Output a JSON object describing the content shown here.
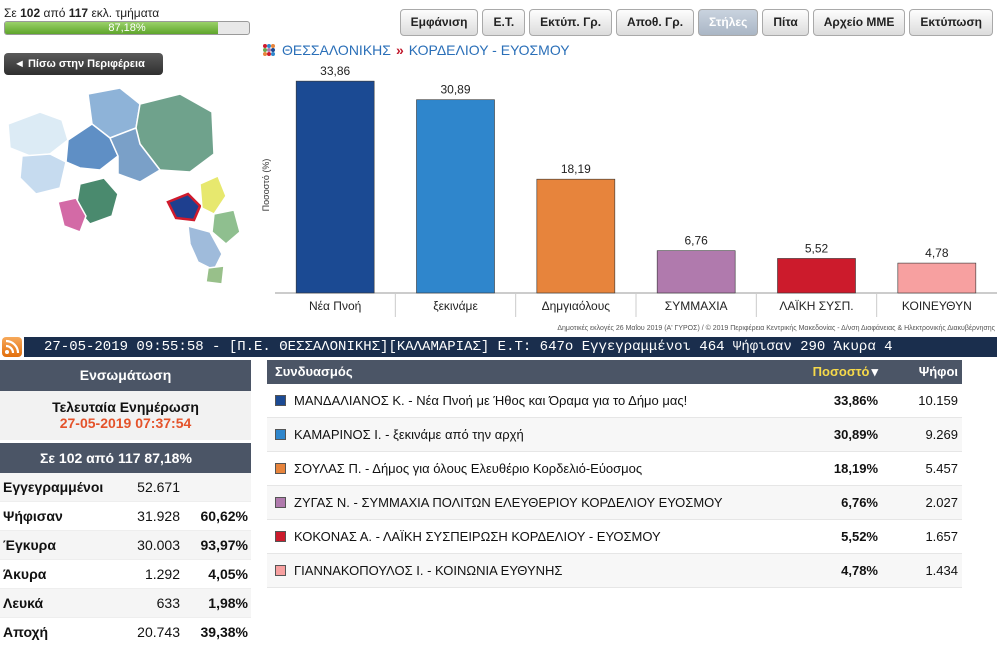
{
  "progress": {
    "prefix": "Σε",
    "counted": "102",
    "middle": "από",
    "total": "117",
    "suffix": "εκλ. τμήματα",
    "percent_label": "87,18%",
    "fraction": 0.8718
  },
  "toolbar": {
    "buttons": [
      "Εμφάνιση",
      "Ε.Τ.",
      "Εκτύπ. Γρ.",
      "Αποθ. Γρ.",
      "Στήλες",
      "Πίτα",
      "Αρχείο ΜΜΕ",
      "Εκτύπωση"
    ],
    "active_index": 4
  },
  "back_button": "◄ Πίσω στην Περιφέρεια",
  "chart_header": {
    "region": "ΘΕΣΣΑΛΟΝΙΚΗΣ",
    "separator": "»",
    "municipality": "ΚΟΡΔΕΛΙΟΥ - ΕΥΟΣΜΟΥ"
  },
  "chart_data": {
    "type": "bar",
    "categories": [
      "Νέα Πνοή",
      "ξεκινάμε",
      "Δημγιαόλους",
      "ΣΥΜΜΑΧΙΑ",
      "ΛΑΪΚΗ ΣΥΣΠ.",
      "ΚΟΙΝΕΥΘΥΝ"
    ],
    "values": [
      33.86,
      30.89,
      18.19,
      6.76,
      5.52,
      4.78
    ],
    "value_labels": [
      "33,86",
      "30,89",
      "18,19",
      "6,76",
      "5,52",
      "4,78"
    ],
    "colors": [
      "#1b4a93",
      "#2f86cc",
      "#e7843c",
      "#b07aad",
      "#cc1b2c",
      "#f7a0a0"
    ],
    "ylabel": "Ποσοστό (%)",
    "ylim": [
      0,
      35
    ],
    "footer": "Δημοτικές εκλογές 26 Μαΐου 2019 (Α' ΓΥΡΟΣ) / © 2019 Περιφέρεια Κεντρικής Μακεδονίας - Δ/νση Διαφάνειας & Ηλεκτρονικής Διακυβέρνησης"
  },
  "ticker": "27-05-2019 09:55:58 - [Π.Ε. ΘΕΣΣΑΛΟΝΙΚΗΣ][ΚΑΛΑΜΑΡΙΑΣ]  Ε.Τ: 647ο  Εγγεγραμμένοι 464  Ψήφισαν 290  Άκυρα 4",
  "left_panel": {
    "header": "Ενσωμάτωση",
    "last_update_title": "Τελευταία Ενημέρωση",
    "last_update_time": "27-05-2019 07:37:54",
    "progress_line": "Σε 102 από  117  87,18%",
    "stats": [
      {
        "label": "Εγγεγραμμένοι",
        "value": "52.671",
        "pct": ""
      },
      {
        "label": "Ψήφισαν",
        "value": "31.928",
        "pct": "60,62%"
      },
      {
        "label": "Έγκυρα",
        "value": "30.003",
        "pct": "93,97%"
      },
      {
        "label": "Άκυρα",
        "value": "1.292",
        "pct": "4,05%"
      },
      {
        "label": "Λευκά",
        "value": "633",
        "pct": "1,98%"
      },
      {
        "label": "Αποχή",
        "value": "20.743",
        "pct": "39,38%"
      }
    ]
  },
  "results": {
    "headers": {
      "name": "Συνδυασμός",
      "pct": "Ποσοστό",
      "sort_icon": "▾",
      "votes": "Ψήφοι"
    },
    "rows": [
      {
        "name": "ΜΑΝΔΑΛΙΑΝΟΣ Κ. - Νέα Πνοή με Ήθος και Όραμα για το Δήμο μας!",
        "pct": "33,86%",
        "votes": "10.159",
        "color": "#1b4a93"
      },
      {
        "name": "ΚΑΜΑΡΙΝΟΣ Ι. - ξεκινάμε από την αρχή",
        "pct": "30,89%",
        "votes": "9.269",
        "color": "#2f86cc"
      },
      {
        "name": "ΣΟΥΛΑΣ Π. - Δήμος για όλους Ελευθέριο Κορδελιό-Εύοσμος",
        "pct": "18,19%",
        "votes": "5.457",
        "color": "#e7843c"
      },
      {
        "name": "ΖΥΓΑΣ Ν. - ΣΥΜΜΑΧΙΑ ΠΟΛΙΤΩΝ ΕΛΕΥΘΕΡΙΟΥ ΚΟΡΔΕΛΙΟΥ ΕΥΟΣΜΟΥ",
        "pct": "6,76%",
        "votes": "2.027",
        "color": "#b07aad"
      },
      {
        "name": "ΚΟΚΟΝΑΣ Α. - ΛΑΪΚΗ ΣΥΣΠΕΙΡΩΣΗ ΚΟΡΔΕΛΙΟΥ - ΕΥΟΣΜΟΥ",
        "pct": "5,52%",
        "votes": "1.657",
        "color": "#cc1b2c"
      },
      {
        "name": "ΓΙΑΝΝΑΚΟΠΟΥΛΟΣ Ι. - ΚΟΙΝΩΝΙΑ ΕΥΘΥΝΗΣ",
        "pct": "4,78%",
        "votes": "1.434",
        "color": "#f7a0a0"
      }
    ]
  }
}
